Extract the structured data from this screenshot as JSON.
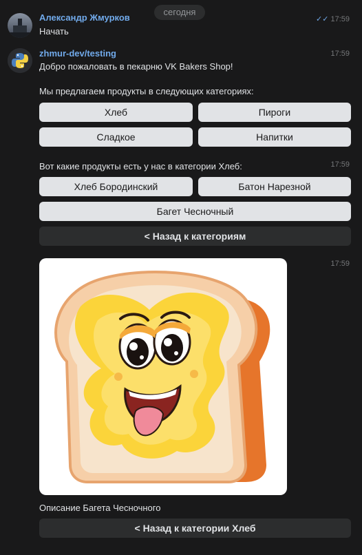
{
  "date_separator": "сегодня",
  "messages": [
    {
      "author": "Александр Жмурков",
      "time": "17:59",
      "text": "Начать",
      "read_status": "double-check-icon"
    },
    {
      "author": "zhmur-dev/testing",
      "time": "17:59",
      "text1": "Добро пожаловать в пекарню VK Bakers Shop!",
      "text2": "Мы предлагаем продукты в следующих категориях:",
      "buttons": [
        "Хлеб",
        "Пироги",
        "Сладкое",
        "Напитки"
      ]
    },
    {
      "time": "17:59",
      "text": "Вот какие продукты есть у нас в категории Хлеб:",
      "buttons": [
        "Хлеб Бородинский",
        "Батон Нарезной",
        "Багет Чесночный"
      ],
      "back_button": "< Назад к категориям"
    },
    {
      "time": "17:59",
      "image": "toast-sticker",
      "caption": "Описание Багета Чесночного",
      "back_button": "< Назад к категории Хлеб"
    }
  ],
  "colors": {
    "background": "#19191a",
    "author": "#71aaeb",
    "button_light": "#e1e3e6",
    "button_dark": "#2c2d2e"
  }
}
